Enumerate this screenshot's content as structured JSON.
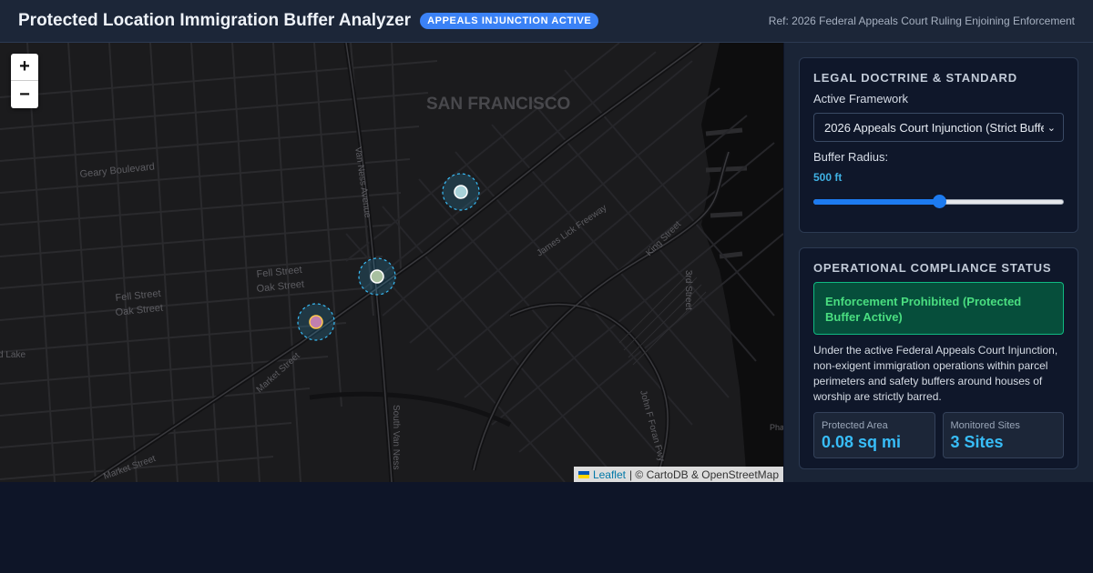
{
  "header": {
    "title": "Protected Location Immigration Buffer Analyzer",
    "badge": "APPEALS INJUNCTION ACTIVE",
    "reference": "Ref: 2026 Federal Appeals Court Ruling Enjoining Enforcement"
  },
  "map": {
    "zoom_in": "+",
    "zoom_out": "−",
    "city_label": "SAN FRANCISCO",
    "street_labels": [
      "Geary Boulevard",
      "Van Ness Avenue",
      "Fell Street",
      "Oak Street",
      "Fell Street",
      "Oak Street",
      "Market Street",
      "James Lick Freeway",
      "King Street",
      "3rd Street",
      "South Van Ness",
      "John F Foran Fwy",
      "Market Street",
      "d Lake",
      "Pha"
    ],
    "attribution": {
      "link": "Leaflet",
      "text": "| © CartoDB & OpenStreetMap"
    },
    "colors": {
      "buffer": "#38bdf8",
      "site_a": "#a7d1d8",
      "site_b": "#a8c0a0",
      "site_c": "#c07fb0"
    }
  },
  "doctrine": {
    "heading": "LEGAL DOCTRINE & STANDARD",
    "framework_label": "Active Framework",
    "framework_value": "2026 Appeals Court Injunction (Strict Buffer)",
    "radius_label": "Buffer Radius:",
    "radius_value": "500 ft",
    "radius_fraction": 0.5
  },
  "status": {
    "heading": "OPERATIONAL COMPLIANCE STATUS",
    "state": "Enforcement Prohibited (Protected Buffer Active)",
    "description": "Under the active Federal Appeals Court Injunction, non-exigent immigration operations within parcel perimeters and safety buffers around houses of worship are strictly barred.",
    "stats": [
      {
        "label": "Protected Area",
        "value": "0.08 sq mi"
      },
      {
        "label": "Monitored Sites",
        "value": "3 Sites"
      }
    ]
  }
}
